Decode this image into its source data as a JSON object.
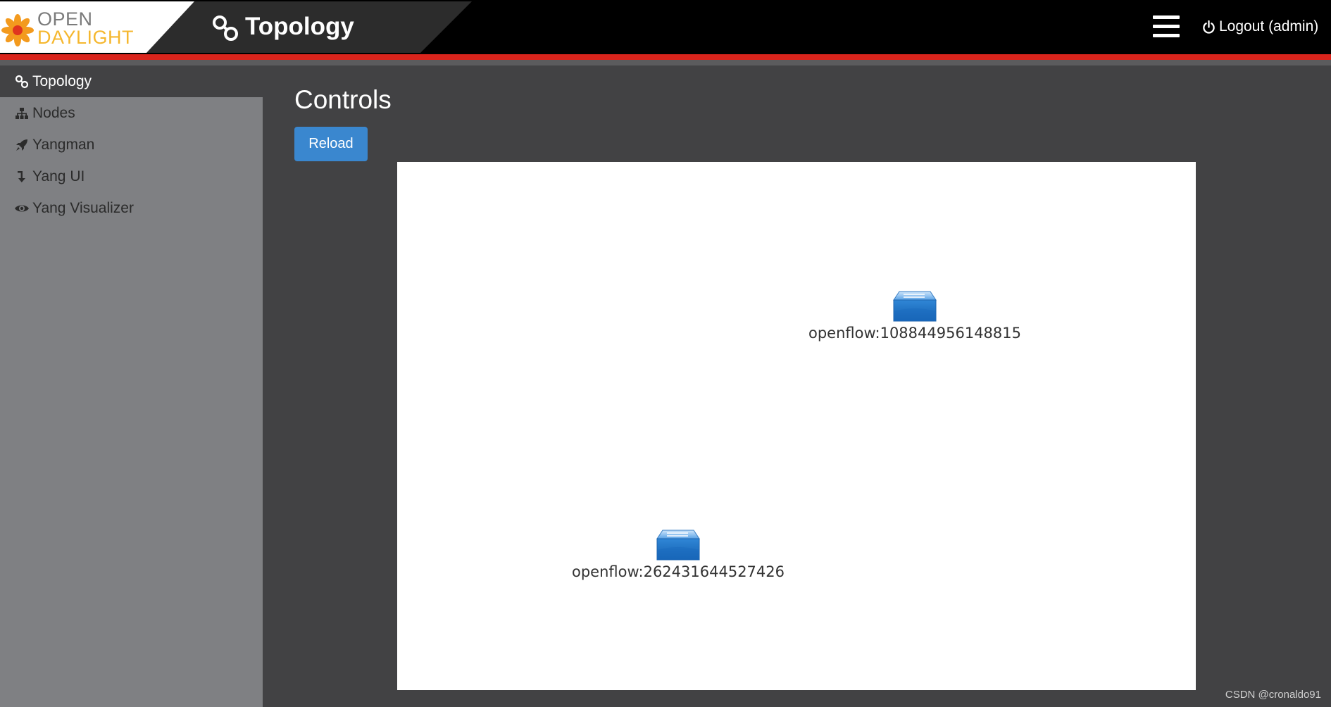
{
  "header": {
    "logo": {
      "line1": "OPEN",
      "line2": "DAYLIGHT"
    },
    "title": "Topology",
    "title_icon": "topology-icon",
    "menu_icon": "hamburger-icon",
    "logout_label": "Logout (admin)",
    "logout_icon": "power-icon"
  },
  "sidebar": {
    "items": [
      {
        "label": "Topology",
        "icon": "topology-icon",
        "active": true
      },
      {
        "label": "Nodes",
        "icon": "sitemap-icon",
        "active": false
      },
      {
        "label": "Yangman",
        "icon": "rocket-icon",
        "active": false
      },
      {
        "label": "Yang UI",
        "icon": "level-down-icon",
        "active": false
      },
      {
        "label": "Yang Visualizer",
        "icon": "eye-icon",
        "active": false
      }
    ]
  },
  "main": {
    "title": "Controls",
    "reload_label": "Reload",
    "nodes": [
      {
        "label": "openflow:108844956148815",
        "icon": "switch-icon"
      },
      {
        "label": "openflow:262431644527426",
        "icon": "switch-icon"
      }
    ]
  },
  "watermark": "CSDN @cronaldo91",
  "colors": {
    "accent_red": "#d9241c",
    "button_blue": "#3a87cf",
    "sidebar_bg": "#7f8083",
    "content_bg": "#424244",
    "logo_orange": "#f5b72e"
  }
}
